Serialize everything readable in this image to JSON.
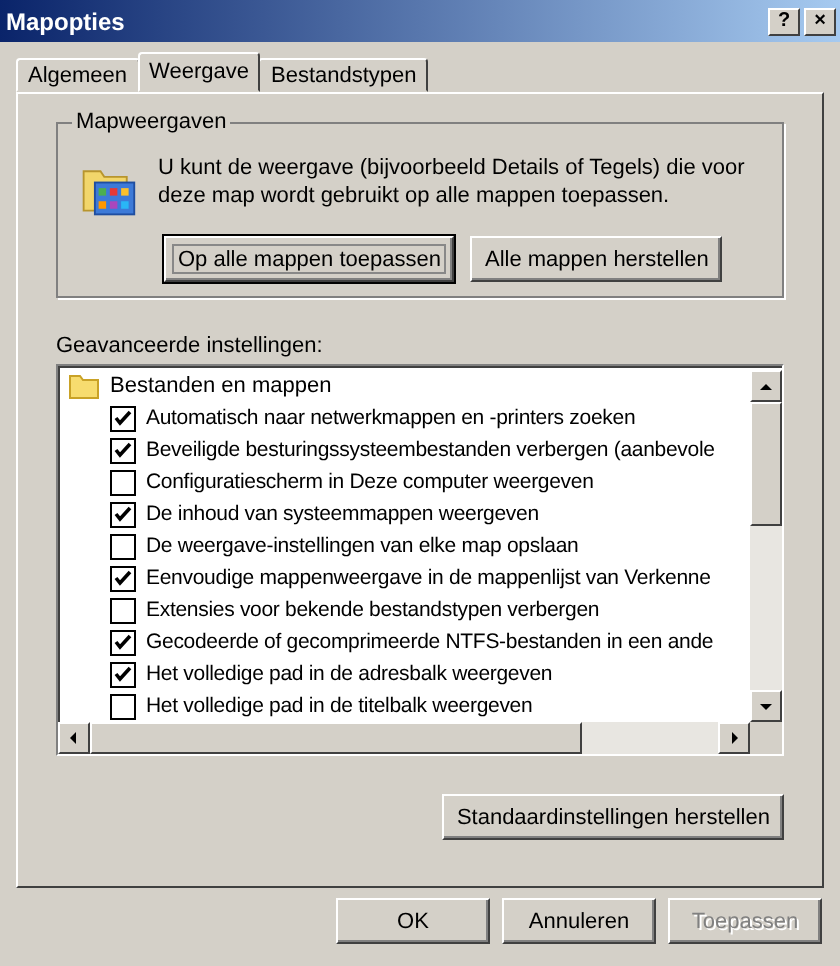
{
  "window": {
    "title": "Mapopties",
    "help_button": "?",
    "close_button": "×"
  },
  "tabs": [
    {
      "label": "Algemeen",
      "selected": false
    },
    {
      "label": "Weergave",
      "selected": true
    },
    {
      "label": "Bestandstypen",
      "selected": false
    }
  ],
  "folder_views": {
    "title": "Mapweergaven",
    "description": "U kunt de weergave (bijvoorbeeld Details of Tegels) die voor deze map wordt gebruikt op alle mappen toepassen.",
    "buttons": [
      {
        "label": "Op alle mappen toepassen",
        "focused": true
      },
      {
        "label": "Alle mappen herstellen",
        "focused": false
      }
    ]
  },
  "advanced": {
    "label": "Geavanceerde instellingen:",
    "group": "Bestanden en mappen",
    "items": [
      {
        "label": "Automatisch naar netwerkmappen en -printers zoeken",
        "checked": true
      },
      {
        "label": "Beveiligde besturingssysteembestanden verbergen (aanbevole",
        "checked": true
      },
      {
        "label": "Configuratiescherm in Deze computer weergeven",
        "checked": false
      },
      {
        "label": "De inhoud van systeemmappen weergeven",
        "checked": true
      },
      {
        "label": "De weergave-instellingen van elke map opslaan",
        "checked": false
      },
      {
        "label": "Eenvoudige mappenweergave in de mappenlijst van Verkenne",
        "checked": true
      },
      {
        "label": "Extensies voor bekende bestandstypen verbergen",
        "checked": false
      },
      {
        "label": "Gecodeerde of gecomprimeerde NTFS-bestanden in een ande",
        "checked": true
      },
      {
        "label": "Het volledige pad in de adresbalk weergeven",
        "checked": true
      },
      {
        "label": "Het volledige pad in de titelbalk weergeven",
        "checked": false
      }
    ],
    "restore_button": "Standaardinstellingen herstellen"
  },
  "buttons": [
    {
      "label": "OK",
      "disabled": false
    },
    {
      "label": "Annuleren",
      "disabled": false
    },
    {
      "label": "Toepassen",
      "disabled": true
    }
  ]
}
